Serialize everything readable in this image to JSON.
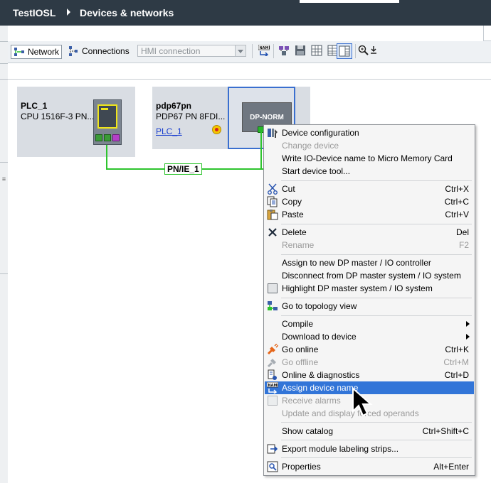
{
  "window": {
    "project": "TestIOSL",
    "section": "Devices & networks"
  },
  "toolbar": {
    "network_label": "Network",
    "connections_label": "Connections",
    "hmi_select_value": "HMI connection",
    "icons": [
      "assign-name-icon",
      "highlight-network-icon",
      "save-icon",
      "grid-view-icon",
      "table-view-icon",
      "zoom-icon",
      "download-icon"
    ]
  },
  "devices": [
    {
      "name": "PLC_1",
      "type": "CPU 1516F-3 PN..."
    },
    {
      "name": "pdp67pn",
      "type": "PDP67 PN 8FDI...",
      "controller_link": "PLC_1",
      "module_label": "DP-NORM"
    }
  ],
  "network": {
    "subnet_label": "PN/IE_1"
  },
  "context_menu": {
    "items": [
      {
        "label": "Device configuration",
        "shortcut": "",
        "icon": "device-config-icon",
        "enabled": true
      },
      {
        "label": "Change device",
        "shortcut": "",
        "icon": "",
        "enabled": false
      },
      {
        "label": "Write IO-Device name to Micro Memory Card",
        "shortcut": "",
        "icon": "",
        "enabled": true
      },
      {
        "label": "Start device tool...",
        "shortcut": "",
        "icon": "",
        "enabled": true
      },
      {
        "label": "Cut",
        "shortcut": "Ctrl+X",
        "icon": "cut-icon",
        "enabled": true
      },
      {
        "label": "Copy",
        "shortcut": "Ctrl+C",
        "icon": "copy-icon",
        "enabled": true
      },
      {
        "label": "Paste",
        "shortcut": "Ctrl+V",
        "icon": "paste-icon",
        "enabled": true
      },
      {
        "label": "Delete",
        "shortcut": "Del",
        "icon": "delete-icon",
        "enabled": true
      },
      {
        "label": "Rename",
        "shortcut": "F2",
        "icon": "",
        "enabled": false
      },
      {
        "label": "Assign to new DP master / IO controller",
        "shortcut": "",
        "icon": "",
        "enabled": true
      },
      {
        "label": "Disconnect from DP master system / IO system",
        "shortcut": "",
        "icon": "",
        "enabled": true
      },
      {
        "label": "Highlight DP master system / IO system",
        "shortcut": "",
        "icon": "checkbox-icon",
        "enabled": true
      },
      {
        "label": "Go to topology view",
        "shortcut": "",
        "icon": "topology-icon",
        "enabled": true
      },
      {
        "label": "Compile",
        "shortcut": "",
        "icon": "",
        "enabled": true,
        "submenu": true
      },
      {
        "label": "Download to device",
        "shortcut": "",
        "icon": "",
        "enabled": true,
        "submenu": true
      },
      {
        "label": "Go online",
        "shortcut": "Ctrl+K",
        "icon": "go-online-icon",
        "enabled": true
      },
      {
        "label": "Go offline",
        "shortcut": "Ctrl+M",
        "icon": "go-offline-icon",
        "enabled": false
      },
      {
        "label": "Online & diagnostics",
        "shortcut": "Ctrl+D",
        "icon": "diagnostics-icon",
        "enabled": true
      },
      {
        "label": "Assign device name",
        "shortcut": "",
        "icon": "assign-name-icon",
        "enabled": true,
        "highlighted": true
      },
      {
        "label": "Receive alarms",
        "shortcut": "",
        "icon": "checkbox-icon",
        "enabled": false
      },
      {
        "label": "Update and display forced operands",
        "shortcut": "",
        "icon": "",
        "enabled": false
      },
      {
        "label": "Show catalog",
        "shortcut": "Ctrl+Shift+C",
        "icon": "",
        "enabled": true
      },
      {
        "label": "Export module labeling strips...",
        "shortcut": "",
        "icon": "export-icon",
        "enabled": true
      },
      {
        "label": "Properties",
        "shortcut": "Alt+Enter",
        "icon": "properties-icon",
        "enabled": true
      }
    ]
  }
}
